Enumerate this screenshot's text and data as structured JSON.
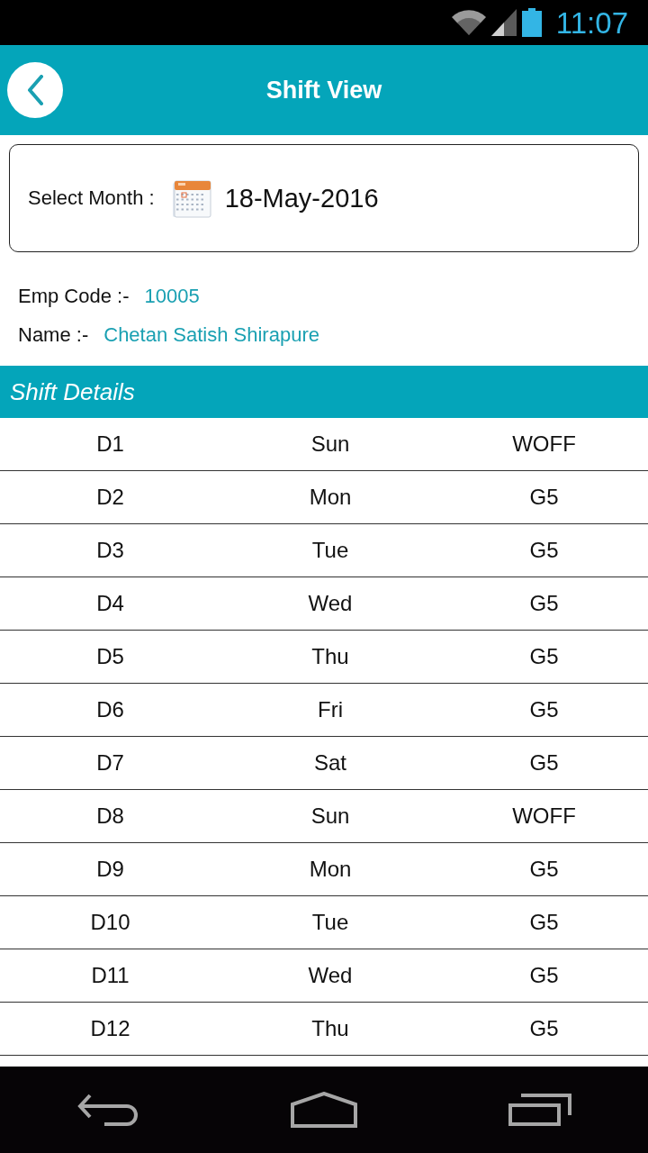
{
  "status_bar": {
    "time": "11:07"
  },
  "header": {
    "title": "Shift View"
  },
  "month_selector": {
    "label": "Select Month :",
    "value": "18-May-2016"
  },
  "employee": [
    {
      "label": "Emp Code :-",
      "value": "10005"
    },
    {
      "label": "Name :-",
      "value": "Chetan Satish Shirapure"
    }
  ],
  "section": {
    "title": "Shift Details"
  },
  "table": {
    "rows": [
      [
        "D1",
        "Sun",
        "WOFF"
      ],
      [
        "D2",
        "Mon",
        "G5"
      ],
      [
        "D3",
        "Tue",
        "G5"
      ],
      [
        "D4",
        "Wed",
        "G5"
      ],
      [
        "D5",
        "Thu",
        "G5"
      ],
      [
        "D6",
        "Fri",
        "G5"
      ],
      [
        "D7",
        "Sat",
        "G5"
      ],
      [
        "D8",
        "Sun",
        "WOFF"
      ],
      [
        "D9",
        "Mon",
        "G5"
      ],
      [
        "D10",
        "Tue",
        "G5"
      ],
      [
        "D11",
        "Wed",
        "G5"
      ],
      [
        "D12",
        "Thu",
        "G5"
      ]
    ]
  }
}
